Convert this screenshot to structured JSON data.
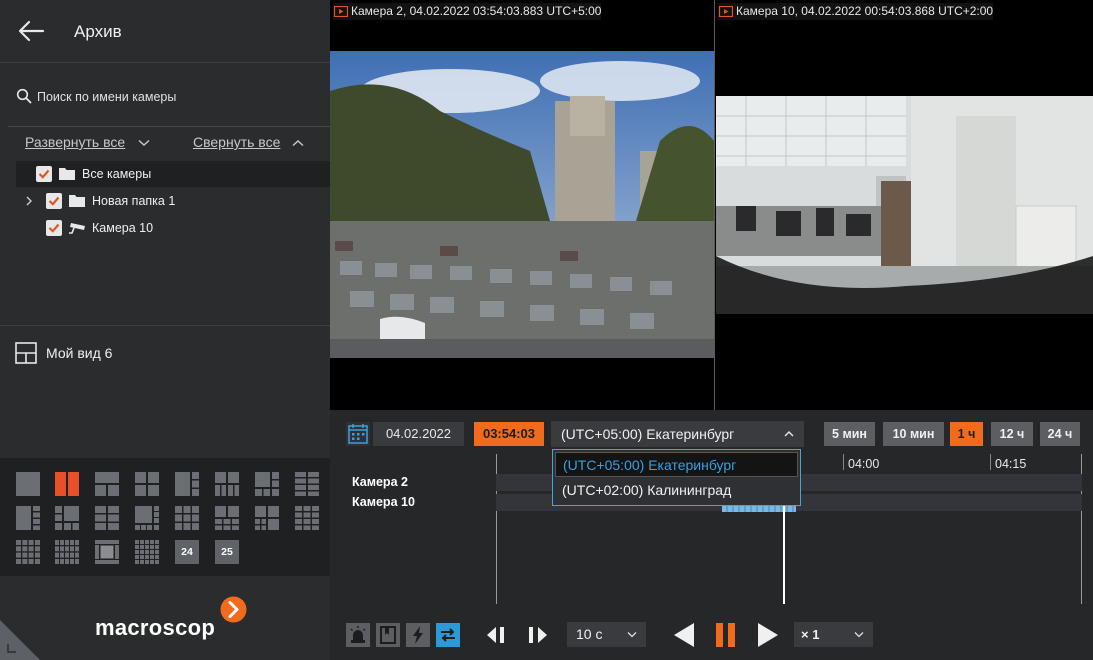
{
  "sidebar": {
    "title": "Архив",
    "search_placeholder": "Поиск по имени камеры",
    "expand_all": "Развернуть все",
    "collapse_all": "Свернуть все",
    "tree": [
      {
        "label": "Все камеры",
        "checked": true,
        "icon": "folder-icon"
      },
      {
        "label": "Новая папка 1",
        "checked": true,
        "icon": "folder-icon"
      },
      {
        "label": "Камера 10",
        "checked": true,
        "icon": "camera-icon"
      }
    ],
    "view_label": "Мой вид 6",
    "layout_numbers": [
      "24",
      "25"
    ],
    "brand": "macroscop"
  },
  "videos": [
    {
      "caption": "Камера 2, 04.02.2022 03:54:03.883 UTC+5:00"
    },
    {
      "caption": "Камера 10, 04.02.2022 00:54:03.868 UTC+2:00"
    }
  ],
  "bottom": {
    "date": "04.02.2022",
    "time": "03:54:03",
    "timezone": "(UTC+05:00) Екатеринбург",
    "timezone_options": [
      "(UTC+05:00) Екатеринбург",
      "(UTC+02:00) Калининград"
    ],
    "scales": [
      "5 мин",
      "10 мин",
      "1 ч",
      "12 ч",
      "24 ч"
    ],
    "active_scale": "1 ч",
    "cameras": [
      "Камера 2",
      "Камера 10"
    ],
    "timeline_labels": [
      "04:00",
      "04:15"
    ],
    "step": "10 с",
    "speed": "× 1"
  },
  "colors": {
    "accent": "#f26b1d",
    "highlight": "#3aa0e0",
    "sidebar": "#2b2c2e"
  }
}
